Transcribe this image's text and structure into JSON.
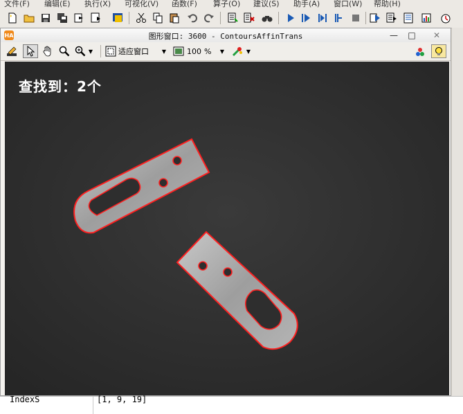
{
  "menu": [
    "文件(F)",
    "编辑(E)",
    "执行(X)",
    "可视化(V)",
    "函数(F)",
    "算子(O)",
    "建议(S)",
    "助手(A)",
    "窗口(W)",
    "帮助(H)"
  ],
  "graphics_window": {
    "logo": "HA",
    "title": "图形窗口: 3600 - ContoursAffinTrans",
    "minimize": "—",
    "maximize": "□",
    "close": "✕"
  },
  "window_toolbar": {
    "fit_window_label": "适应窗口",
    "zoom_value": "100",
    "zoom_unit": "%"
  },
  "canvas": {
    "result_text": "查找到：2个",
    "contour_color": "#ff2020"
  },
  "variable_row": {
    "name": "IndexS",
    "value": "[1, 9, 19]"
  }
}
